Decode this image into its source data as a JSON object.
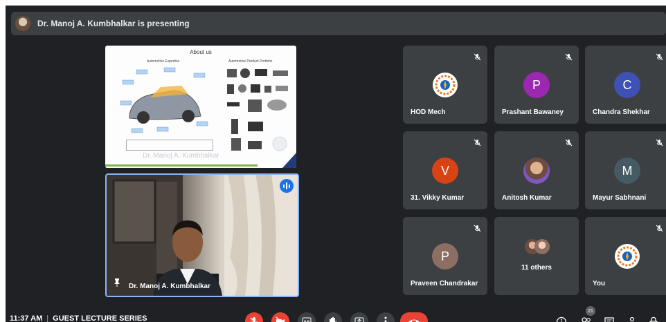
{
  "presenting": {
    "text": "Dr. Manoj A. Kumbhalkar is presenting"
  },
  "slide": {
    "title": "About us",
    "left_heading": "Automotive Expertise",
    "right_heading": "Automotive Product Portfolio",
    "footer_name": "Dr. Manoj A. Kumbhalkar"
  },
  "camera": {
    "name": "Dr. Manoj A. Kumbhalkar"
  },
  "participants": [
    {
      "name": "HOD Mech",
      "initial": "",
      "color": "#ffffff",
      "avatar": "emblem-logo"
    },
    {
      "name": "Prashant Bawaney",
      "initial": "P",
      "color": "#9c27b0",
      "avatar": "letter"
    },
    {
      "name": "Chandra Shekhar",
      "initial": "C",
      "color": "#3f51b5",
      "avatar": "letter"
    },
    {
      "name": "31. Vikky Kumar",
      "initial": "V",
      "color": "#d84315",
      "avatar": "letter"
    },
    {
      "name": "Anitosh Kumar",
      "initial": "",
      "color": "#6d4c41",
      "avatar": "photo"
    },
    {
      "name": "Mayur Sabhnani",
      "initial": "M",
      "color": "#455a64",
      "avatar": "letter"
    },
    {
      "name": "Praveen Chandrakar",
      "initial": "P",
      "color": "#8d6e63",
      "avatar": "letter"
    },
    {
      "name": "11 others",
      "initial": "",
      "color": "#5f6368",
      "avatar": "group"
    },
    {
      "name": "You",
      "initial": "",
      "color": "#ffffff",
      "avatar": "emblem-logo"
    }
  ],
  "meeting": {
    "time": "11:37 AM",
    "title": "GUEST LECTURE SERIES"
  },
  "participant_count": "21",
  "colors": {
    "stage": "#202124",
    "tile": "#3c4043",
    "accent": "#8ab4f8",
    "danger": "#ea4335"
  }
}
